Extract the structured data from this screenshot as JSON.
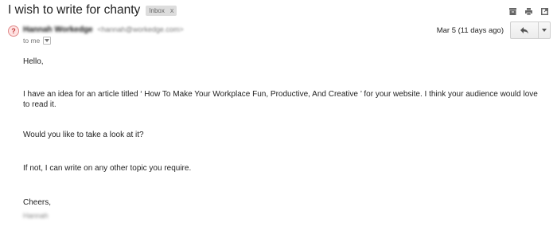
{
  "email": {
    "subject": "I wish to write for chanty",
    "label": {
      "text": "Inbox",
      "close": "x"
    },
    "sender": {
      "avatar_text": "?",
      "name": "Hannah Workedge",
      "email": "<hannah@workedge.com>"
    },
    "recipient_text": "to me",
    "date": "Mar 5 (11 days ago)",
    "body": {
      "greeting": "Hello,",
      "paragraph1": "I have an idea for an article titled ‘ How To Make Your Workplace Fun, Productive, And Creative ’ for your website. I think your audience would love to read it.",
      "paragraph2": "Would you like to take a look at it?",
      "paragraph3": "If not, I can write on any other topic you require.",
      "signoff": "Cheers,",
      "signature": "Hannah"
    }
  },
  "icons": {
    "archive": "archive-icon",
    "print": "print-icon",
    "new_window": "new-window-icon",
    "reply": "reply-icon",
    "more": "chevron-down-icon"
  }
}
